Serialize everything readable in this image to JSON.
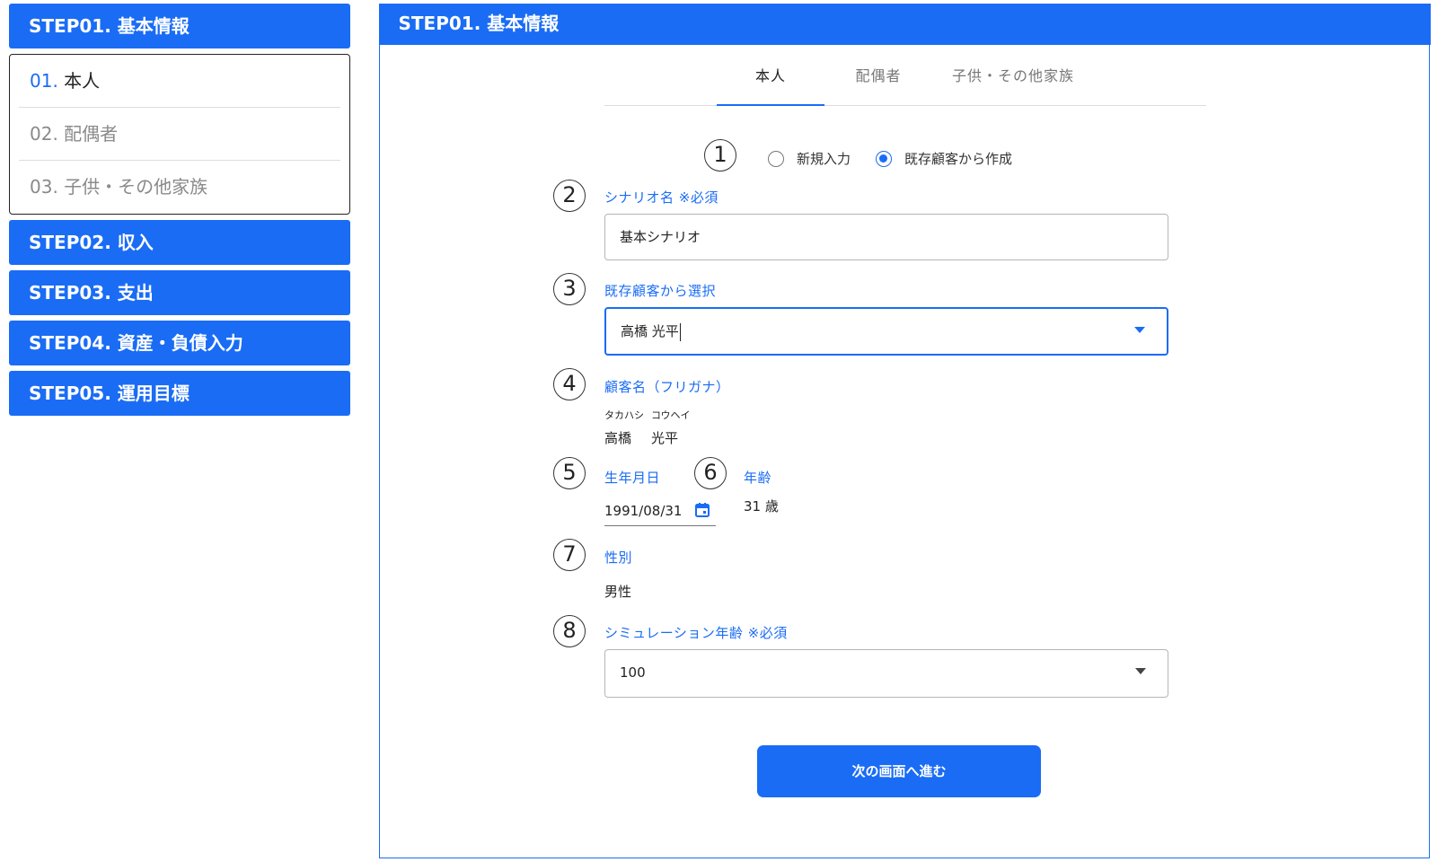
{
  "sidebar": {
    "step01": "STEP01. 基本情報",
    "sub_items": [
      {
        "num": "01.",
        "label": "本人"
      },
      {
        "num": "02.",
        "label": "配偶者"
      },
      {
        "num": "03.",
        "label": "子供・その他家族"
      }
    ],
    "step02": "STEP02. 収入",
    "step03": "STEP03. 支出",
    "step04": "STEP04. 資産・負債入力",
    "step05": "STEP05. 運用目標"
  },
  "main": {
    "header": "STEP01. 基本情報",
    "tabs": [
      "本人",
      "配偶者",
      "子供・その他家族"
    ],
    "markers": [
      "1",
      "2",
      "3",
      "4",
      "5",
      "6",
      "7",
      "8"
    ],
    "radio": {
      "option1": "新規入力",
      "option2": "既存顧客から作成",
      "selected": "既存顧客から作成"
    },
    "scenario": {
      "label": "シナリオ名 ※必須",
      "value": "基本シナリオ"
    },
    "existing": {
      "label": "既存顧客から選択",
      "value": "高橋 光平"
    },
    "kana": {
      "label": "顧客名（フリガナ）",
      "ruby_last": "タカハシ",
      "ruby_first": "コウヘイ",
      "last": "高橋",
      "first": "光平"
    },
    "birth": {
      "label": "生年月日",
      "value": "1991/08/31"
    },
    "age": {
      "label": "年齢",
      "value": "31 歳"
    },
    "gender": {
      "label": "性別",
      "value": "男性"
    },
    "sim_age": {
      "label": "シミュレーション年齢 ※必須",
      "value": "100"
    },
    "next_button": "次の画面へ進む"
  },
  "colors": {
    "accent": "#1a6cf5"
  }
}
